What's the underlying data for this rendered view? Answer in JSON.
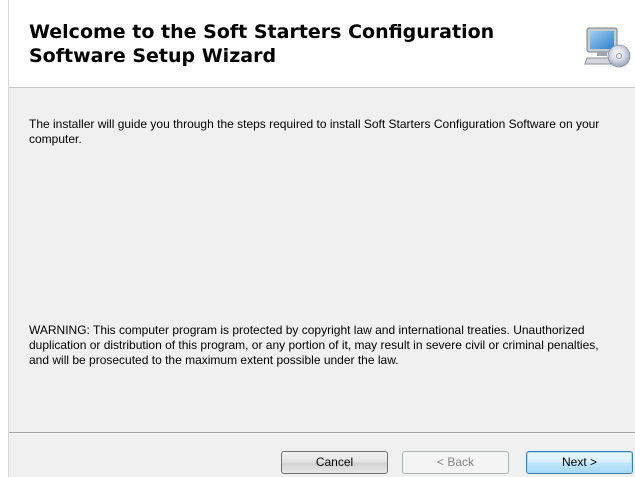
{
  "banner": {
    "title": "Welcome to the Soft Starters Configuration\nSoftware Setup Wizard",
    "icon": "computer-cd-icon"
  },
  "content": {
    "intro": "The installer will guide you through the steps required to install Soft Starters Configuration Software on your computer.",
    "warning": "WARNING: This computer program is protected by copyright law and international treaties. Unauthorized duplication or distribution of this program, or any portion of it, may result in severe civil or criminal penalties, and will be prosecuted to the maximum extent possible under the law."
  },
  "buttons": {
    "cancel": "Cancel",
    "back": "< Back",
    "next": "Next >"
  },
  "colors": {
    "background": "#f0f0f0",
    "banner": "#ffffff"
  }
}
